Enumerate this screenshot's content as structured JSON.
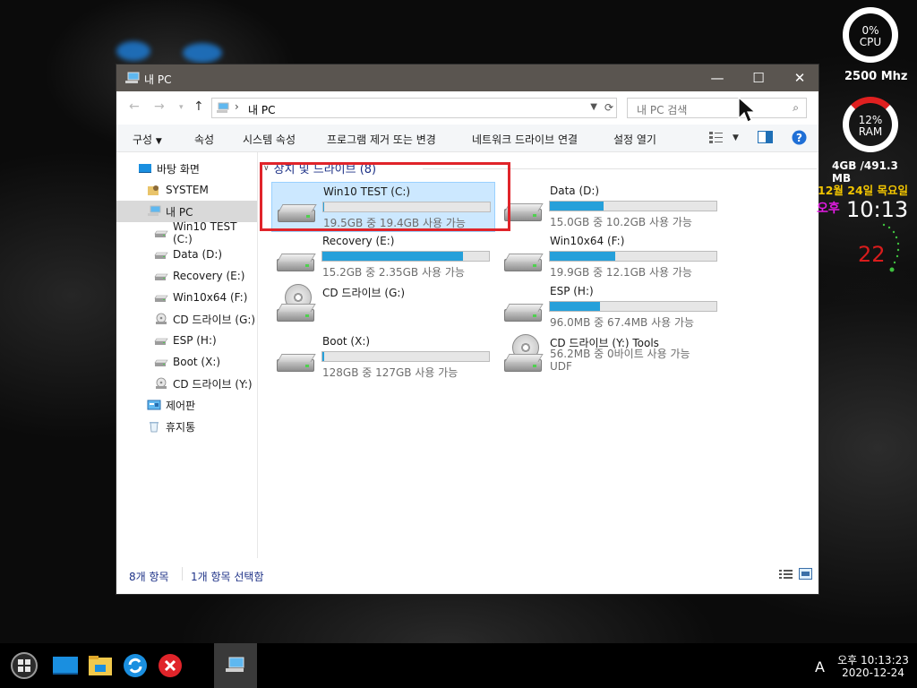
{
  "window": {
    "title": "내 PC",
    "address_path": "내 PC",
    "search_placeholder": "내 PC 검색",
    "controls": {
      "minimize": "—",
      "maximize": "☐",
      "close": "✕"
    }
  },
  "commandbar": {
    "organize": "구성",
    "properties": "속성",
    "system_properties": "시스템 속성",
    "uninstall": "프로그램 제거 또는 변경",
    "map_drive": "네트워크 드라이브 연결",
    "open_settings": "설정 열기"
  },
  "nav": {
    "items": [
      {
        "label": "바탕 화면",
        "icon": "desktop-icon"
      },
      {
        "label": "SYSTEM",
        "icon": "user-folder-icon"
      },
      {
        "label": "내 PC",
        "icon": "computer-icon"
      },
      {
        "label": "Win10 TEST (C:)",
        "icon": "drive-icon"
      },
      {
        "label": "Data (D:)",
        "icon": "drive-icon"
      },
      {
        "label": "Recovery (E:)",
        "icon": "drive-icon"
      },
      {
        "label": "Win10x64 (F:)",
        "icon": "drive-icon"
      },
      {
        "label": "CD 드라이브 (G:)",
        "icon": "cd-drive-icon"
      },
      {
        "label": "ESP (H:)",
        "icon": "drive-icon"
      },
      {
        "label": "Boot (X:)",
        "icon": "drive-icon"
      },
      {
        "label": "CD 드라이브 (Y:)",
        "icon": "cd-drive-icon"
      },
      {
        "label": "제어판",
        "icon": "control-panel-icon"
      },
      {
        "label": "휴지통",
        "icon": "recycle-bin-icon"
      }
    ]
  },
  "content": {
    "group_header": "장치 및 드라이브 (8)",
    "drives": [
      {
        "name": "Win10 TEST (C:)",
        "info": "19.5GB 중 19.4GB 사용 가능",
        "used": 0.005,
        "type": "hdd"
      },
      {
        "name": "Data (D:)",
        "info": "15.0GB 중 10.2GB 사용 가능",
        "used": 0.32,
        "type": "hdd"
      },
      {
        "name": "Recovery (E:)",
        "info": "15.2GB 중 2.35GB 사용 가능",
        "used": 0.845,
        "type": "hdd"
      },
      {
        "name": "Win10x64 (F:)",
        "info": "19.9GB 중 12.1GB 사용 가능",
        "used": 0.39,
        "type": "hdd"
      },
      {
        "name": "CD 드라이브 (G:)",
        "type": "cd"
      },
      {
        "name": "ESP (H:)",
        "info": "96.0MB 중 67.4MB 사용 가능",
        "used": 0.3,
        "type": "hdd"
      },
      {
        "name": "Boot (X:)",
        "info": "128GB 중 127GB 사용 가능",
        "used": 0.01,
        "type": "hdd"
      },
      {
        "name": "CD 드라이브 (Y:) Tools",
        "info": "56.2MB 중 0바이트 사용 가능",
        "fs": "UDF",
        "type": "cd"
      }
    ]
  },
  "status": {
    "count": "8개 항목",
    "selected": "1개 항목 선택함"
  },
  "widgets": {
    "cpu_label": "CPU",
    "cpu_value": "0%",
    "cpu_load": 0.0,
    "cpu_freq": "2500 Mhz",
    "ram_label": "RAM",
    "ram_value": "12%",
    "ram_load": 0.12,
    "ram_usage": "4GB /491.3 MB",
    "date": "12월 24일 목요일",
    "ampm": "오후",
    "time": "10:13",
    "seconds": "22"
  },
  "taskbar": {
    "ime": "A",
    "clock_time": "오후 10:13:23",
    "clock_date": "2020-12-24"
  },
  "colors": {
    "accent": "#26a0da",
    "selection": "#cce8ff",
    "highlight": "#e0242a",
    "date": "#f2c500",
    "ampm": "#e31ae3",
    "seconds": "#d81c1c"
  }
}
